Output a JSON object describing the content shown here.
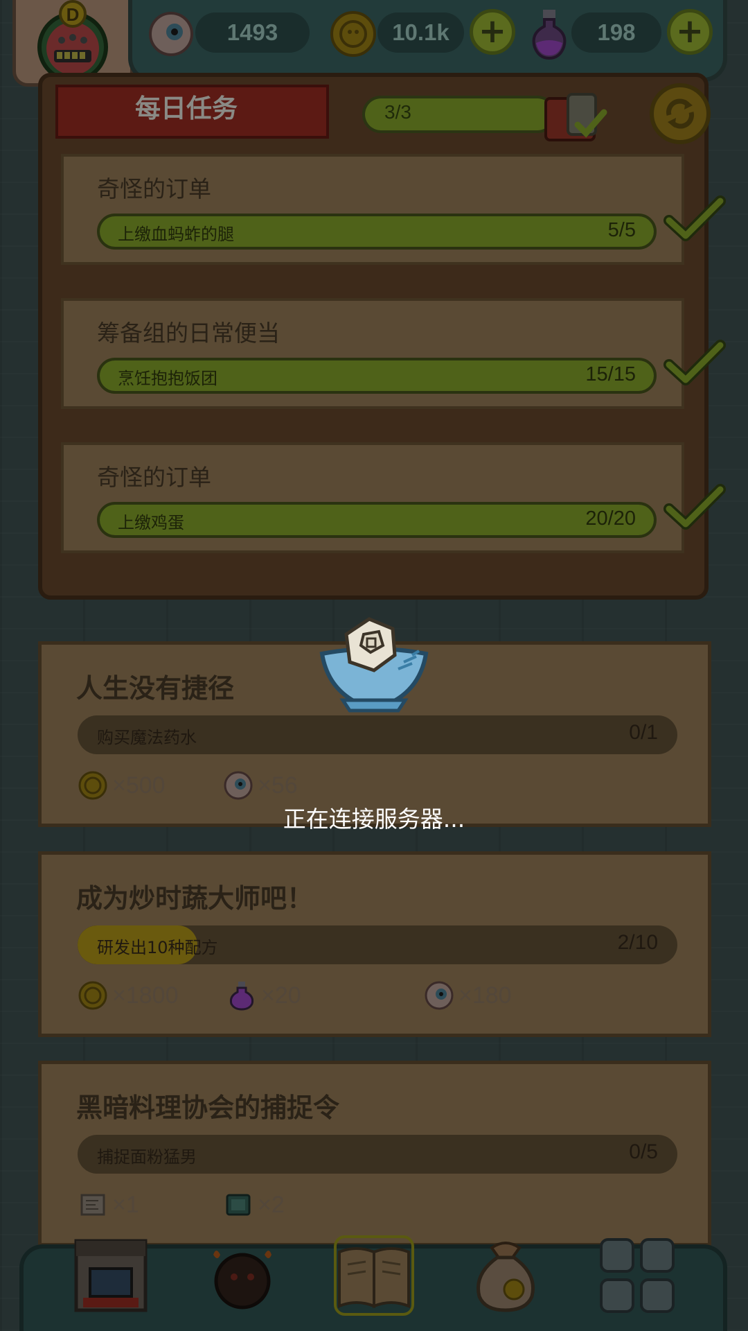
{
  "resources": {
    "eyeball": {
      "value": "1493"
    },
    "gold": {
      "value": "10.1k"
    },
    "potion": {
      "value": "198"
    },
    "add_symbol": "+"
  },
  "avatar": {
    "rank_letter": "D"
  },
  "daily": {
    "title": "每日任务",
    "progress_text": "3/3",
    "progress": 1.0,
    "tasks": [
      {
        "title": "奇怪的订单",
        "label": "上缴血蚂蚱的腿",
        "count": "5/5",
        "progress": 1.0,
        "done": true
      },
      {
        "title": "筹备组的日常便当",
        "label": "烹饪抱抱饭团",
        "count": "15/15",
        "progress": 1.0,
        "done": true
      },
      {
        "title": "奇怪的订单",
        "label": "上缴鸡蛋",
        "count": "20/20",
        "progress": 1.0,
        "done": true
      }
    ]
  },
  "quests": [
    {
      "title": "人生没有捷径",
      "label": "购买魔法药水",
      "count": "0/1",
      "progress": 0.0,
      "rewards": [
        {
          "icon": "gold-coin-icon",
          "amount": "×500"
        },
        {
          "icon": "eyeball-icon",
          "amount": "×56"
        }
      ]
    },
    {
      "title": "成为炒时蔬大师吧！",
      "label": "研发出10种配方",
      "count": "2/10",
      "progress": 0.2,
      "rewards": [
        {
          "icon": "gold-coin-icon",
          "amount": "×1800"
        },
        {
          "icon": "potion-icon",
          "amount": "×20"
        },
        {
          "icon": "eyeball-icon",
          "amount": "×180"
        }
      ]
    },
    {
      "title": "黑暗料理协会的捕捉令",
      "label": "捕捉面粉猛男",
      "count": "0/5",
      "progress": 0.0,
      "rewards": [
        {
          "icon": "map-scroll-icon",
          "amount": "×1"
        },
        {
          "icon": "card-icon",
          "amount": "×2"
        }
      ]
    }
  ],
  "loading": {
    "text": "正在连接服务器..."
  },
  "nav": {
    "items": [
      "restaurant-icon",
      "monster-icon",
      "quest-book-icon",
      "money-bag-icon",
      "grid-menu-icon"
    ],
    "active": "quest-book-icon"
  },
  "colors": {
    "overlay": "#000000",
    "bar_green": "#4f6219",
    "bar_gold": "#6a5a0e",
    "parchment": "#5a4a34",
    "plus_green": "#5b6b1e"
  }
}
